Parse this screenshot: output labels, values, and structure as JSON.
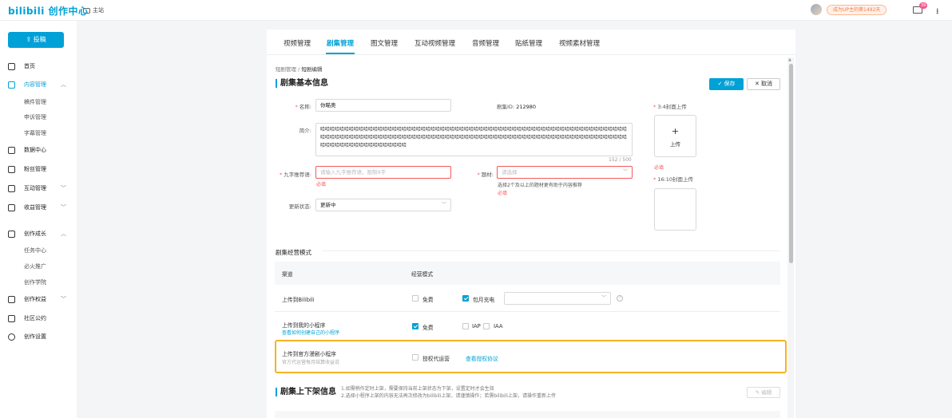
{
  "topbar": {
    "logo": "bilibili 创作中心",
    "home_label": "主站",
    "promo": "成为UP主的第1492天",
    "mail_count": "39"
  },
  "sidebar": {
    "upload_label": "投稿",
    "items": [
      {
        "label": "首页",
        "icon": "home-icon"
      },
      {
        "label": "内容管理",
        "icon": "document-icon",
        "active": true,
        "expanded": true
      },
      {
        "label": "数据中心",
        "icon": "chart-icon"
      },
      {
        "label": "粉丝管理",
        "icon": "user-icon"
      },
      {
        "label": "互动管理",
        "icon": "chat-icon"
      },
      {
        "label": "收益管理",
        "icon": "money-icon"
      },
      {
        "label": "创作成长",
        "icon": "cap-icon",
        "expanded": true
      },
      {
        "label": "创作权益",
        "icon": "flag-icon"
      },
      {
        "label": "社区公约",
        "icon": "book-icon"
      },
      {
        "label": "创作设置",
        "icon": "settings-icon"
      }
    ],
    "content_sub": [
      "稿件管理",
      "申诉管理",
      "字幕管理"
    ],
    "growth_sub": [
      "任务中心",
      "必火推广",
      "创作学院"
    ]
  },
  "tabs": [
    "视频管理",
    "剧集管理",
    "图文管理",
    "互动视频管理",
    "音频管理",
    "贴纸管理",
    "视频素材管理"
  ],
  "active_tab": "剧集管理",
  "breadcrumb": {
    "parent": "短剧管理",
    "sep": "/",
    "current": "短剧编辑"
  },
  "basic": {
    "title": "剧集基本信息",
    "save_label": "保存",
    "cancel_label": "取消",
    "name_label": "名称:",
    "name_value": "你瞄奥",
    "id_label": "剧集ID:",
    "id_value": "212980",
    "intro_label": "简介:",
    "intro_text": "哈哈哈哈哈哈哈哈哈哈哈哈哈哈哈哈哈哈哈哈哈哈哈哈哈哈哈哈哈哈哈哈哈哈哈哈哈哈哈哈哈哈哈哈哈哈哈哈哈哈哈哈哈哈哈哈哈哈哈哈哈哈哈哈哈哈哈哈哈哈哈哈哈哈哈哈哈哈哈哈哈哈哈哈哈哈哈哈哈哈哈哈哈哈哈哈哈哈哈哈哈哈哈哈哈哈哈哈哈哈哈哈哈哈哈哈哈哈哈哈哈哈哈哈哈哈哈哈哈哈哈哈哈哈哈哈哈哈哈哈哈哈哈哈哈哈",
    "intro_count": "152 / 500",
    "slogan_label": "九字推荐语:",
    "slogan_placeholder": "请输入九字推荐语，限制9字",
    "required_text": "必填",
    "topic_label": "题材:",
    "topic_placeholder": "请选择",
    "topic_hint": "选择2个及以上的题材更有助于内容推荐",
    "status_label": "更新状态:",
    "status_value": "更新中",
    "cover34_label": "3:4封面上传",
    "cover_upload": "上传",
    "cover1610_label": "16:10封面上传"
  },
  "operation": {
    "title": "剧集经营模式",
    "col_channel": "渠道",
    "col_mode": "经营模式",
    "rows": [
      {
        "channel": "上传到Bilibili",
        "opt1": "免费",
        "opt2": "包月充电"
      },
      {
        "channel": "上传到我的小程序",
        "link": "查看如何创建自己的小程序",
        "opt1": "免费",
        "opt2": "IAP",
        "opt3": "IAA"
      },
      {
        "channel": "上传到官方漫剧小程序",
        "sub": "官方代运营每月结算收益说",
        "opt1": "授权代运营",
        "link": "查看授权协议"
      }
    ]
  },
  "shelf": {
    "title": "剧集上下架信息",
    "note1": "1.如需稍作定时上架，需要保持当前上架状态为下架，设置定时才会生效",
    "note2": "2.选择小程序上架的内容无法再次修改为bilibili上架，请谨慎操作；若需bilibili上架，请操作重新上传",
    "edit_label": "编辑"
  }
}
